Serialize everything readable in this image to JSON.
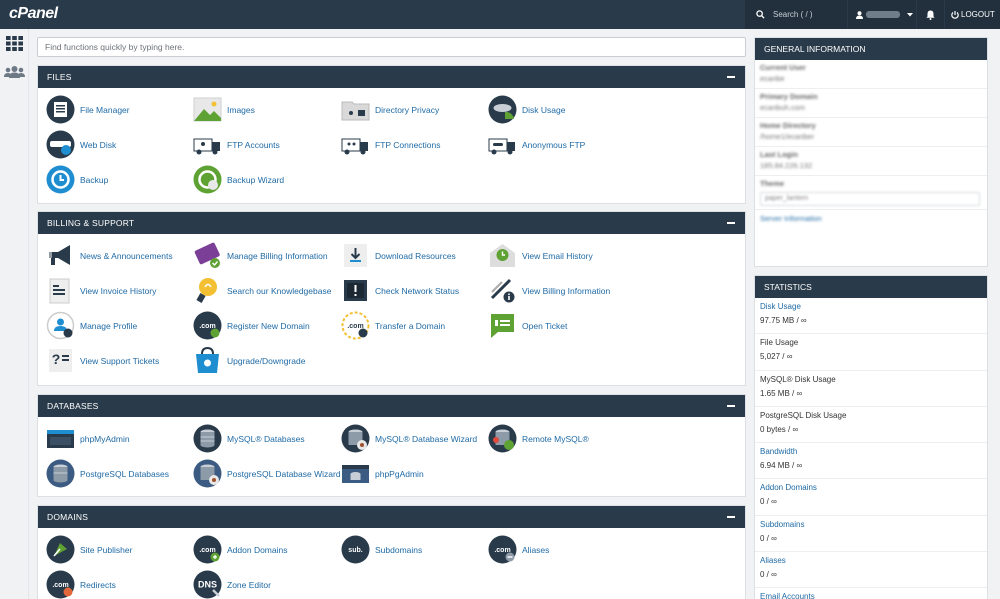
{
  "brand": {
    "logo": "cPanel"
  },
  "topbar": {
    "search_placeholder": "Search ( / )",
    "username": "cecanber",
    "logout_label": "LOGOUT"
  },
  "main_search": {
    "placeholder": "Find functions quickly by typing here."
  },
  "sections": {
    "files": {
      "title": "FILES",
      "items": [
        "File Manager",
        "Images",
        "Directory Privacy",
        "Disk Usage",
        "Web Disk",
        "FTP Accounts",
        "FTP Connections",
        "Anonymous FTP",
        "Backup",
        "Backup Wizard"
      ]
    },
    "billing": {
      "title": "BILLING & SUPPORT",
      "items": [
        "News & Announcements",
        "Manage Billing Information",
        "Download Resources",
        "View Email History",
        "View Invoice History",
        "Search our Knowledgebase",
        "Check Network Status",
        "View Billing Information",
        "Manage Profile",
        "Register New Domain",
        "Transfer a Domain",
        "Open Ticket",
        "View Support Tickets",
        "Upgrade/Downgrade"
      ]
    },
    "databases": {
      "title": "DATABASES",
      "items": [
        "phpMyAdmin",
        "MySQL® Databases",
        "MySQL® Database Wizard",
        "Remote MySQL®",
        "PostgreSQL Databases",
        "PostgreSQL Database Wizard",
        "phpPgAdmin"
      ]
    },
    "domains": {
      "title": "DOMAINS",
      "items": [
        "Site Publisher",
        "Addon Domains",
        "Subdomains",
        "Aliases",
        "Redirects",
        "Zone Editor"
      ]
    }
  },
  "general_info": {
    "title": "GENERAL INFORMATION",
    "rows": [
      {
        "label": "Current User",
        "value": "ecanbe"
      },
      {
        "label": "Primary Domain",
        "value": "ecanbuh.com"
      },
      {
        "label": "Home Directory",
        "value": "/home1/ecanber"
      },
      {
        "label": "Last Login",
        "value": "185.84.226.132"
      }
    ],
    "theme_label": "Theme",
    "theme_value": "paper_lantern",
    "server_info_link": "Server Information"
  },
  "statistics": {
    "title": "STATISTICS",
    "rows": [
      {
        "label": "Disk Usage",
        "value": "97.75 MB / ∞",
        "link": true
      },
      {
        "label": "File Usage",
        "value": "5,027 / ∞",
        "link": false
      },
      {
        "label": "MySQL® Disk Usage",
        "value": "1.65 MB / ∞",
        "link": false
      },
      {
        "label": "PostgreSQL Disk Usage",
        "value": "0 bytes / ∞",
        "link": false
      },
      {
        "label": "Bandwidth",
        "value": "6.94 MB / ∞",
        "link": true
      },
      {
        "label": "Addon Domains",
        "value": "0 / ∞",
        "link": true
      },
      {
        "label": "Subdomains",
        "value": "0 / ∞",
        "link": true
      },
      {
        "label": "Aliases",
        "value": "0 / ∞",
        "link": true
      },
      {
        "label": "Email Accounts",
        "value": "",
        "link": true
      }
    ]
  },
  "colors": {
    "nav": "#293a4a",
    "link": "#1f6aa5",
    "accent_green": "#5ea234",
    "accent_blue": "#1f8ed1"
  }
}
